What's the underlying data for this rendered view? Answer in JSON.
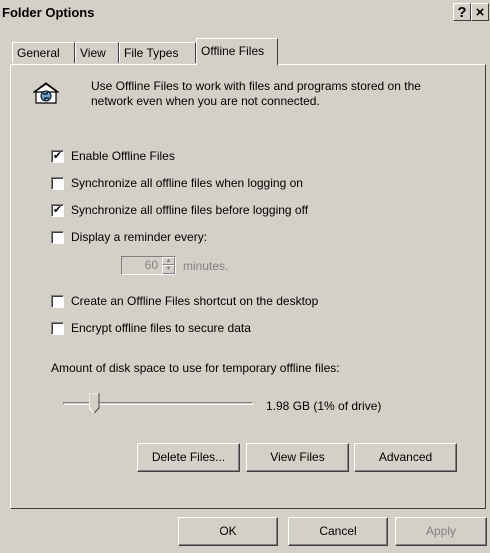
{
  "window": {
    "title": "Folder Options",
    "help_label": "?",
    "close_label": "×"
  },
  "tabs": [
    {
      "label": "General"
    },
    {
      "label": "View"
    },
    {
      "label": "File Types"
    },
    {
      "label": "Offline Files",
      "active": true
    }
  ],
  "intro": {
    "text": "Use Offline Files to work with files and programs stored on the network even when you are not connected.",
    "icon": "offline-sync-icon"
  },
  "options": {
    "enable_offline": {
      "label": "Enable Offline Files",
      "checked": true
    },
    "sync_logon": {
      "label": "Synchronize all offline files when logging on",
      "checked": false
    },
    "sync_logoff": {
      "label": "Synchronize all offline files before logging off",
      "checked": true
    },
    "reminder": {
      "label": "Display a reminder every:",
      "checked": false
    },
    "reminder_value": "60",
    "reminder_unit": "minutes.",
    "shortcut": {
      "label": "Create an Offline Files shortcut on the desktop",
      "checked": false
    },
    "encrypt": {
      "label": "Encrypt offline files to secure data",
      "checked": false
    }
  },
  "disk_space": {
    "label": "Amount of disk space to use for temporary offline files:",
    "value_text": "1.98 GB (1% of drive)",
    "slider_fraction": 0.15
  },
  "buttons": {
    "delete_files": "Delete Files...",
    "view_files": "View Files",
    "advanced": "Advanced",
    "ok": "OK",
    "cancel": "Cancel",
    "apply": "Apply"
  },
  "colors": {
    "face": "#d4d0c8",
    "disabled_text": "#808080"
  }
}
